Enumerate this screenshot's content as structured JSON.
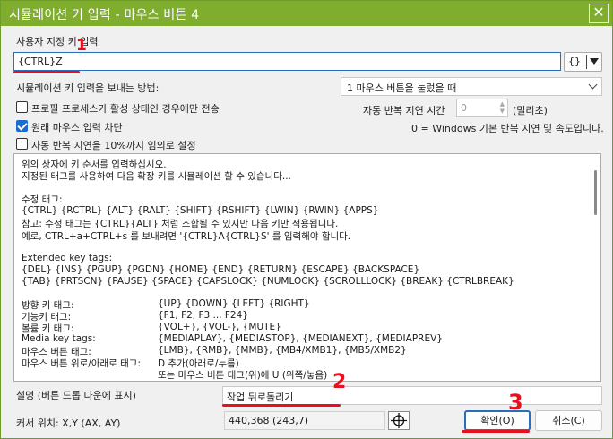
{
  "window": {
    "title": "시뮬레이션 키 입력 - 마우스 버튼 4",
    "close_glyph": "✕"
  },
  "key_input": {
    "label": "사용자 지정 키 입력",
    "value": "{CTRL}Z",
    "braces_button": "{}"
  },
  "simulation_method": {
    "label": "시뮬레이션 키 입력을 보내는 방법:",
    "selected": "1 마우스 버튼을 눌렀을 때"
  },
  "options": {
    "send_only_active": "프로필 프로세스가 활성 상태인 경우에만 전송",
    "block_original": "원래 마우스 입력 차단",
    "random_repeat": "자동 반복 지연을 10%까지 임의로 설정"
  },
  "repeat_delay": {
    "label": "자동 반복 지연 시간",
    "value": "0",
    "unit": "(밀리초)",
    "note": "0 = Windows 기본 반복 지연 및 속도입니다."
  },
  "help": {
    "lines": [
      "위의 상자에 키 순서를 입력하십시오.",
      "지정된 태그를 사용하여 다음 확장 키를 시뮬레이션 할 수 있습니다...",
      "수정 태그:",
      " {CTRL} {RCTRL} {ALT} {RALT} {SHIFT} {RSHIFT} {LWIN} {RWIN} {APPS}",
      " 참고:     수정 태그는 {CTRL}{ALT} 처럼 조합될 수 있지만 다음 키만 적용됩니다.",
      "              예로, CTRL+a+CTRL+s 를 보내려면 '{CTRL}A{CTRL}S' 를 입력해야 합니다.",
      "Extended key tags:",
      " {DEL} {INS} {PGUP} {PGDN} {HOME} {END} {RETURN} {ESCAPE} {BACKSPACE}",
      " {TAB} {PRTSCN} {PAUSE} {SPACE} {CAPSLOCK} {NUMLOCK} {SCROLLLOCK} {BREAK} {CTRLBREAK}"
    ],
    "pairs": [
      {
        "k": "방향 키 태그:",
        "v": "{UP} {DOWN} {LEFT} {RIGHT}"
      },
      {
        "k": "기능키 태그:",
        "v": "{F1, F2, F3 ... F24}"
      },
      {
        "k": "볼륨 키 태그:",
        "v": "{VOL+}, {VOL-}, {MUTE}"
      },
      {
        "k": "Media key tags:",
        "v": "{MEDIAPLAY}, {MEDIASTOP}, {MEDIANEXT}, {MEDIAPREV}"
      },
      {
        "k": "마우스 버튼 태그:",
        "v": "{LMB}, {RMB}, {MMB}, {MB4/XMB1}, {MB5/XMB2}"
      },
      {
        "k": "마우스 버튼 위로/아래로 태그:",
        "v": "             D 추가(아래로/누름)"
      },
      {
        "k": "",
        "v": "또는 마우스 버튼 태그(위)에 U (위쪽/놓음)"
      }
    ]
  },
  "description": {
    "label": "설명 (버튼 드롭 다운에 표시)",
    "value": "작업 뒤로돌리기"
  },
  "cursor": {
    "label": "커서 위치: X,Y (AX, AY)",
    "value": "440,368 (243,7)"
  },
  "buttons": {
    "ok": "확인(O)",
    "cancel": "취소(C)"
  },
  "annotations": {
    "one": "1",
    "two": "2",
    "three": "3"
  },
  "colors": {
    "accent": "#7fae2e",
    "annotation": "#e8101c",
    "check": "#1a6dd0"
  }
}
